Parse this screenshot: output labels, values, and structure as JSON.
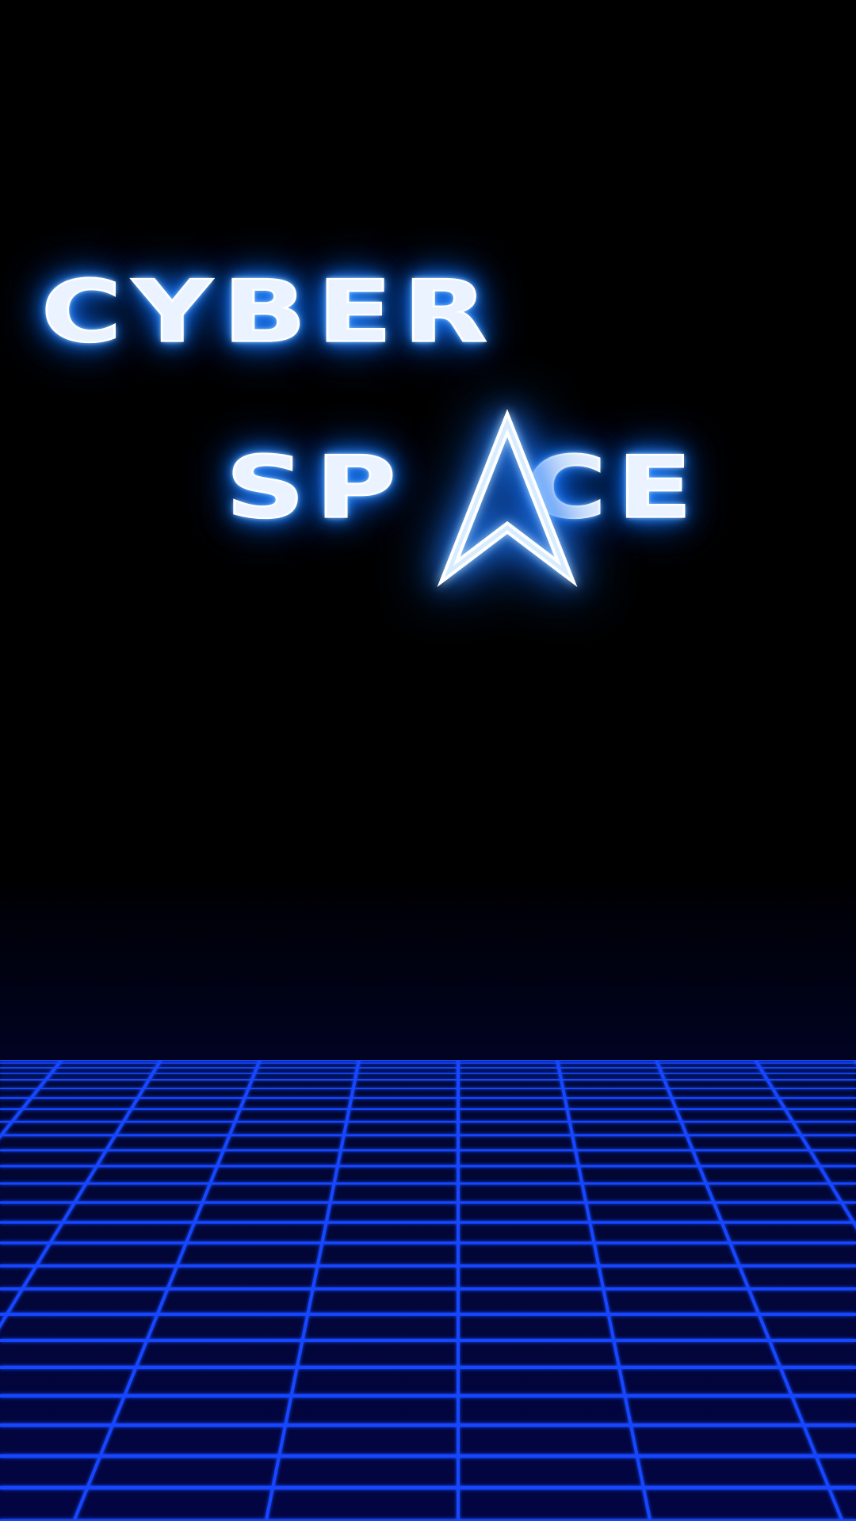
{
  "title_screen": {
    "logo_line_1": "CYBER",
    "logo_line_2_part_1": "SP",
    "logo_line_2_part_2": "CE",
    "logo_letter_a_icon": "arrowhead-icon"
  },
  "colors": {
    "background": "#000000",
    "grid_line": "#1446ff",
    "grid_floor": "#020542",
    "logo_fill": "#eaf3ff",
    "logo_glow": "#1f7cff"
  }
}
